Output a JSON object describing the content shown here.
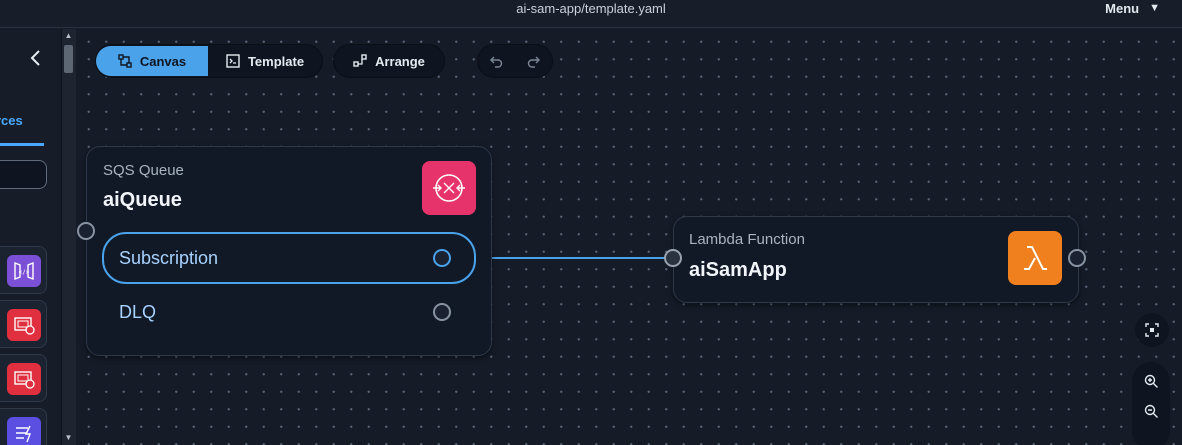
{
  "window": {
    "title": "ai-sam-app/template.yaml",
    "menu_label": "Menu"
  },
  "left_panel": {
    "tab_label": "rces",
    "resource_icons": [
      "api-gateway-icon",
      "eventbridge-schedule-icon",
      "eventbridge-schedule-icon",
      "step-functions-icon"
    ]
  },
  "toolbar": {
    "canvas_label": "Canvas",
    "template_label": "Template",
    "arrange_label": "Arrange"
  },
  "nodes": {
    "sqs": {
      "kind": "SQS Queue",
      "name": "aiQueue",
      "rows": [
        {
          "label": "Subscription",
          "selected": true
        },
        {
          "label": "DLQ",
          "selected": false
        }
      ]
    },
    "lambda": {
      "kind": "Lambda Function",
      "name": "aiSamApp"
    }
  },
  "colors": {
    "accent": "#4aa2ea",
    "sqs_badge": "#e7336b",
    "lambda_badge": "#f07f1d",
    "background": "#151c28"
  }
}
